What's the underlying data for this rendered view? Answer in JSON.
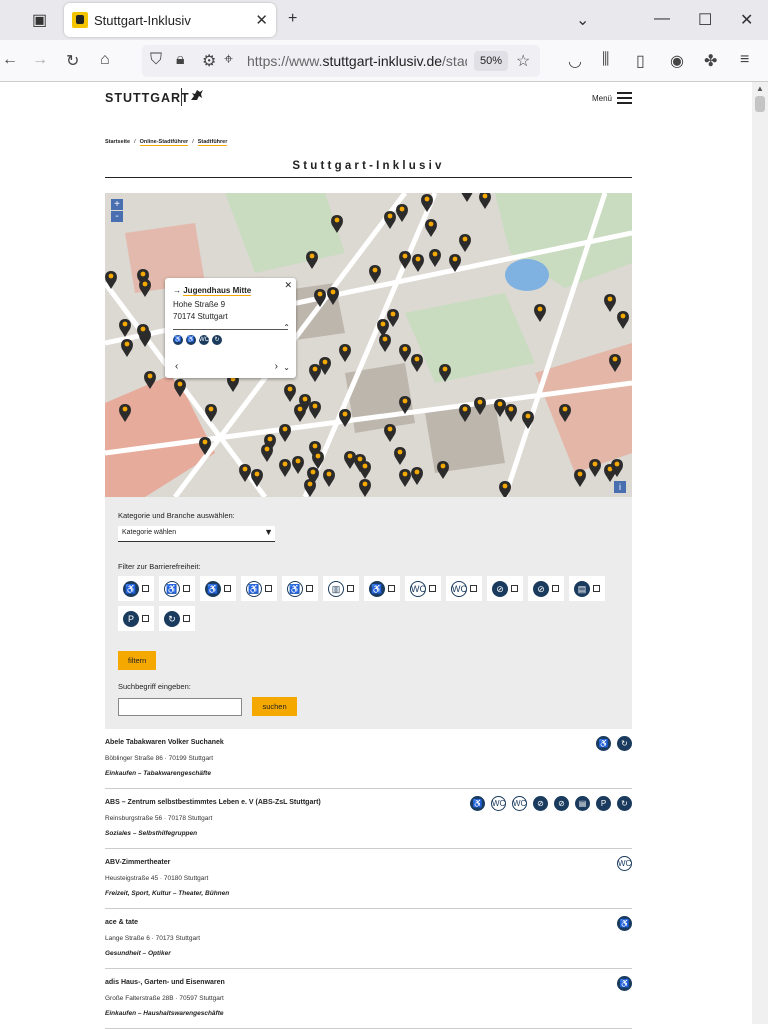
{
  "browser": {
    "tab_title": "Stuttgart-Inklusiv",
    "url_prefix": "https://www.",
    "url_domain": "stuttgart-inklusiv.de",
    "url_rest": "/stad",
    "zoom": "50%"
  },
  "header": {
    "logo": "STUTTGART",
    "menu_label": "Menü"
  },
  "breadcrumb": {
    "home": "Startseite",
    "level2": "Online-Stadtführer",
    "level3": "Stadtführer"
  },
  "page_title": "Stuttgart-Inklusiv",
  "map": {
    "zoom_in": "+",
    "zoom_out": "-",
    "info": "i",
    "popup": {
      "arrow": "→",
      "name": "Jugendhaus Mitte",
      "street": "Hohe Straße 9",
      "city": "70174 Stuttgart",
      "close": "✕",
      "prev": "‹",
      "next": "›",
      "icons": [
        "♿",
        "♿",
        "WC",
        "↻"
      ]
    },
    "colors": {
      "pin": "#2b2b2b",
      "pin_dot": "#f5a800",
      "park": "#c9dcc0",
      "building": "#e8a08c",
      "water": "#7fb2e0"
    }
  },
  "filter": {
    "category_label": "Kategorie und Branche auswählen:",
    "category_value": "Kategorie wählen",
    "caret": "▼",
    "access_label": "Filter zur Barrierefreiheit:",
    "access_icons": [
      {
        "glyph": "♿",
        "style": "dark"
      },
      {
        "glyph": "♿",
        "style": "light"
      },
      {
        "glyph": "♿",
        "style": "dark"
      },
      {
        "glyph": "♿",
        "style": "light"
      },
      {
        "glyph": "♿",
        "style": "light"
      },
      {
        "glyph": "▥",
        "style": "light"
      },
      {
        "glyph": "♿",
        "style": "dark"
      },
      {
        "glyph": "WC",
        "style": "light"
      },
      {
        "glyph": "WC",
        "style": "light"
      },
      {
        "glyph": "⊘",
        "style": "dark"
      },
      {
        "glyph": "⊘",
        "style": "dark"
      },
      {
        "glyph": "▤",
        "style": "dark"
      },
      {
        "glyph": "P",
        "style": "dark"
      },
      {
        "glyph": "↻",
        "style": "dark"
      }
    ],
    "filter_button": "filtern",
    "search_label": "Suchbegriff eingeben:",
    "search_button": "suchen"
  },
  "entries": [
    {
      "name": "Abele Tabakwaren Volker Suchanek",
      "address": "Böblinger Straße 86 · 70199 Stuttgart",
      "category": "Einkaufen – Tabakwarengeschäfte",
      "icons": [
        "♿",
        "↻"
      ]
    },
    {
      "name": "ABS – Zentrum selbstbestimmtes Leben e. V (ABS-ZsL Stuttgart)",
      "address": "Reinsburgstraße 56 · 70178 Stuttgart",
      "category": "Soziales – Selbsthilfegruppen",
      "icons": [
        "♿",
        "WC",
        "WC",
        "⊘",
        "⊘",
        "▤",
        "P",
        "↻"
      ]
    },
    {
      "name": "ABV-Zimmertheater",
      "address": "Heusteigstraße 45 · 70180 Stuttgart",
      "category": "Freizeit, Sport, Kultur – Theater, Bühnen",
      "icons": [
        "WC"
      ]
    },
    {
      "name": "ace & tate",
      "address": "Lange Straße 6 · 70173 Stuttgart",
      "category": "Gesundheit – Optiker",
      "icons": [
        "♿"
      ]
    },
    {
      "name": "adis Haus-, Garten- und Eisenwaren",
      "address": "Große Falterstraße 28B · 70597 Stuttgart",
      "category": "Einkaufen – Haushaltswarengeschäfte",
      "icons": [
        "♿"
      ]
    }
  ]
}
